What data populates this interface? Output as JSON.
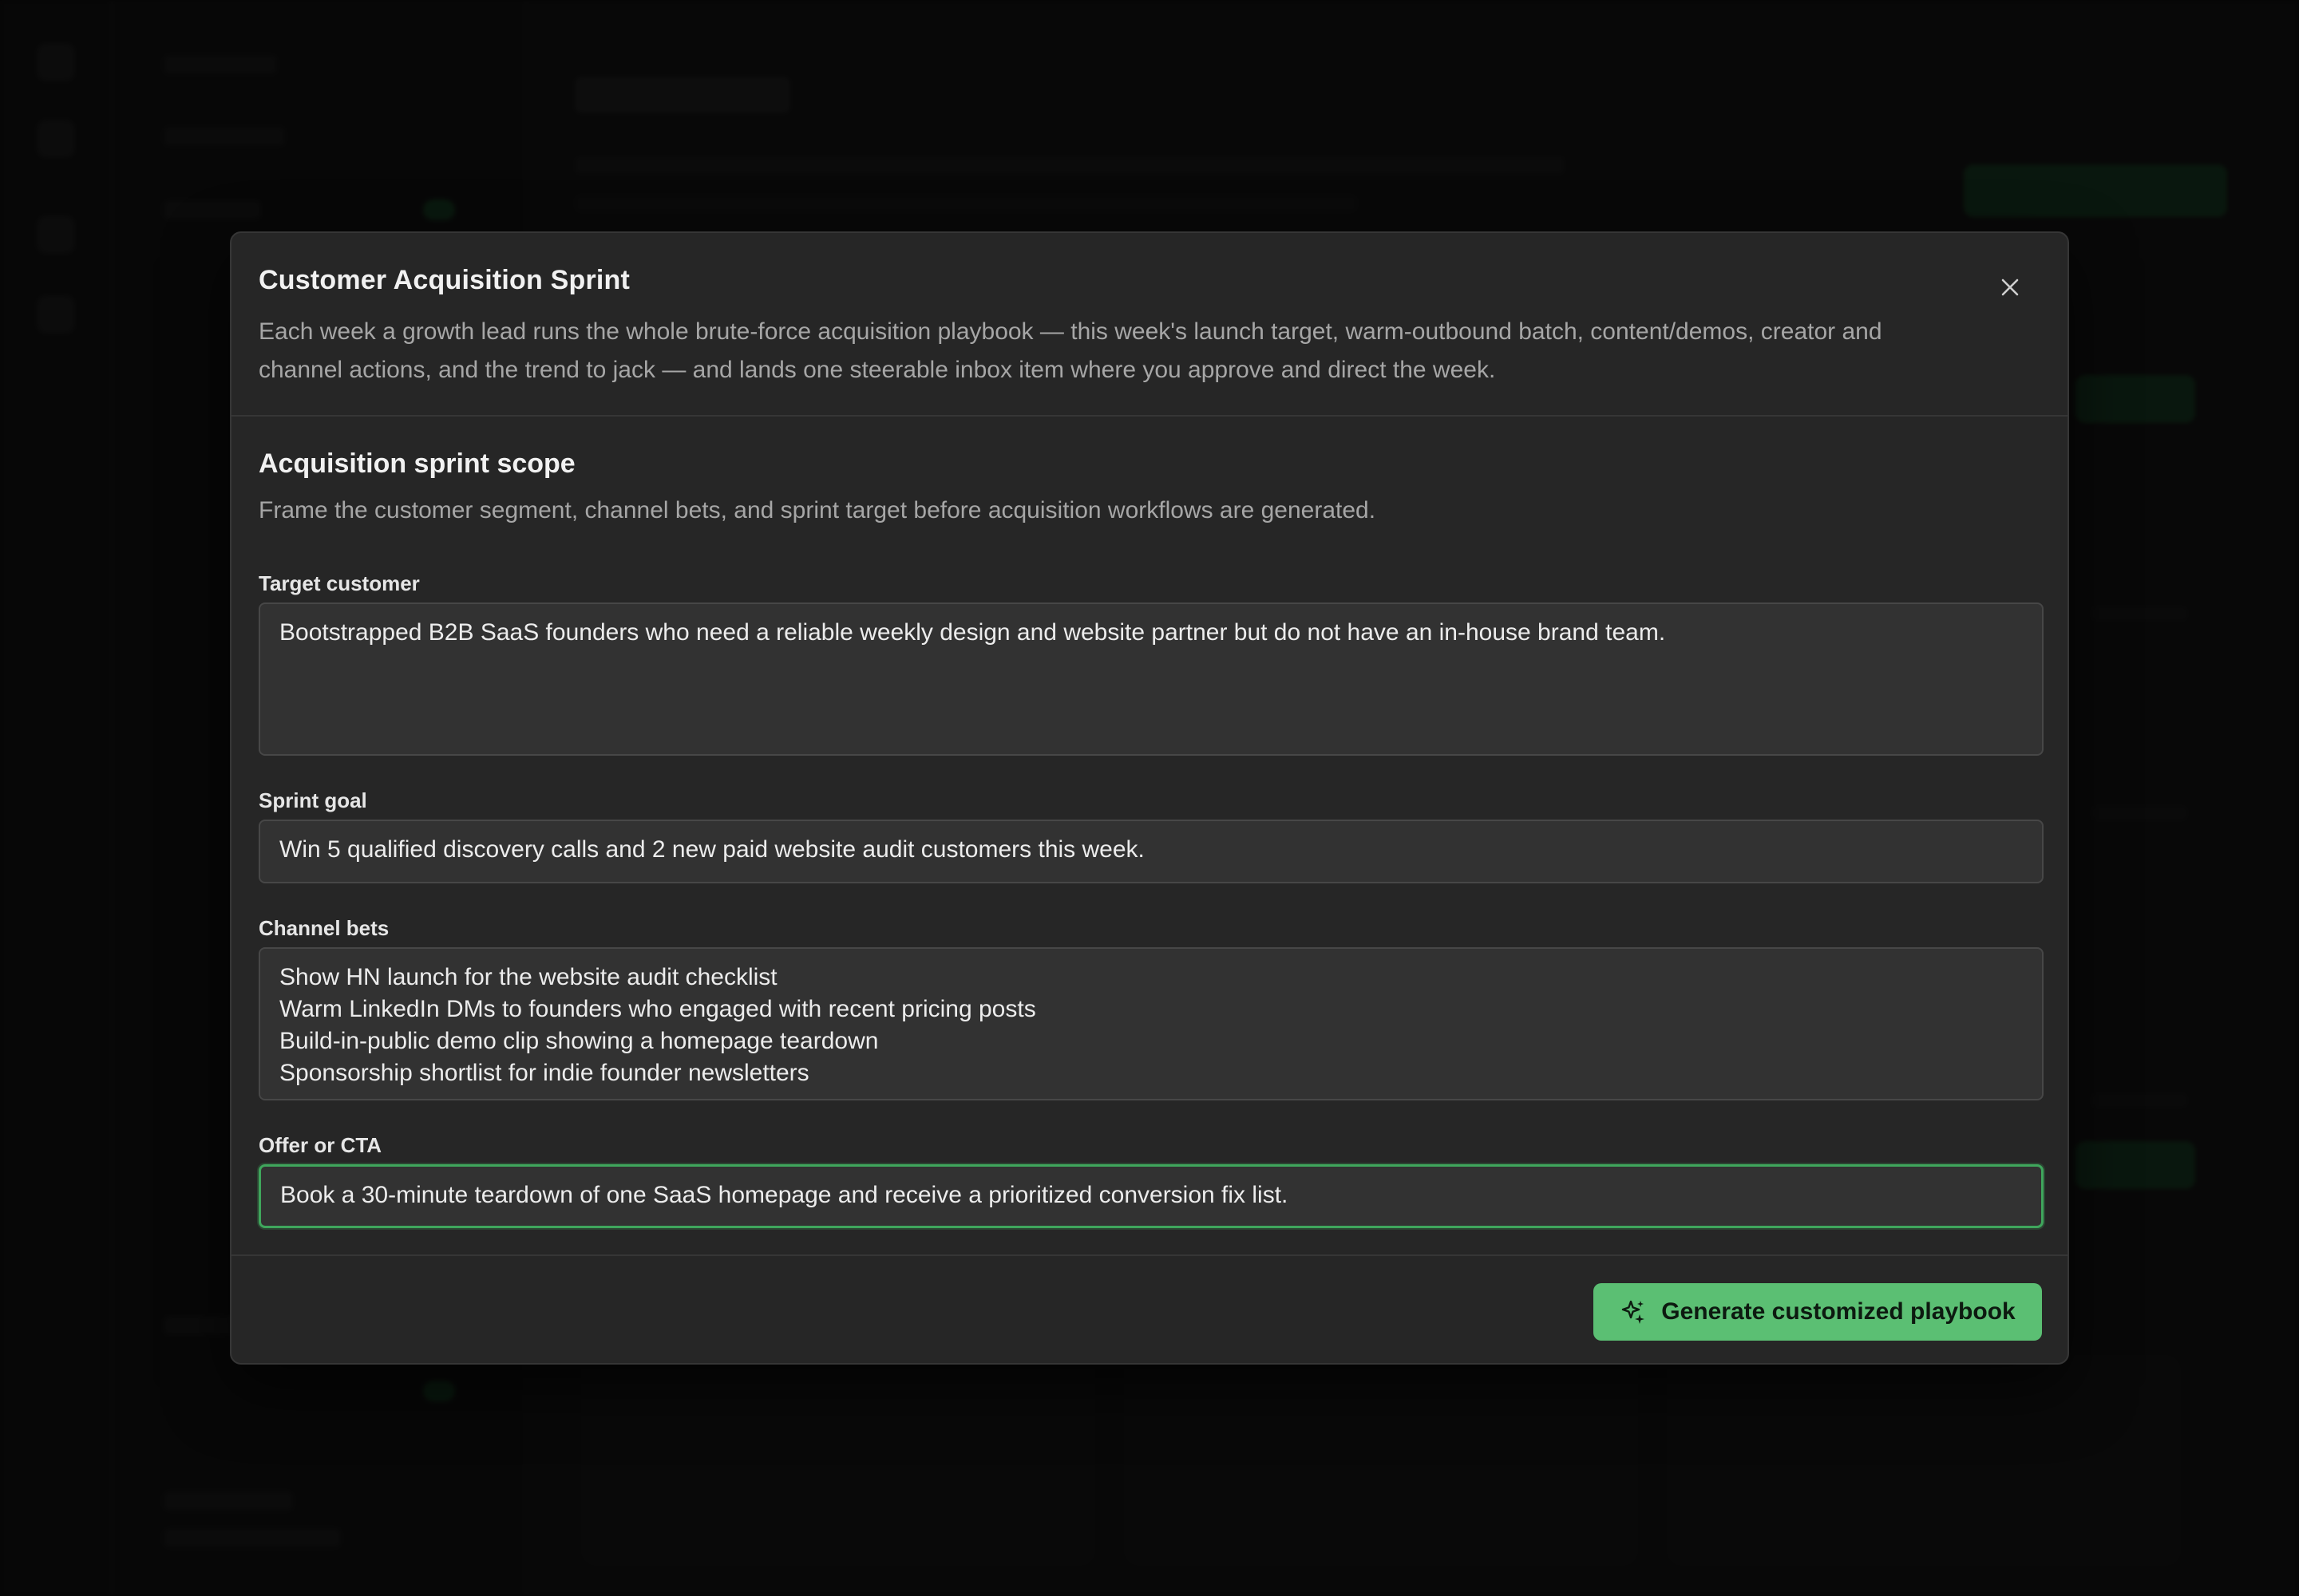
{
  "modal": {
    "title": "Customer Acquisition Sprint",
    "description": "Each week a growth lead runs the whole brute-force acquisition playbook — this week's launch target, warm-outbound batch, content/demos, creator and channel actions, and the trend to jack — and lands one steerable inbox item where you approve and direct the week.",
    "close_icon": "close-icon",
    "section": {
      "title": "Acquisition sprint scope",
      "description": "Frame the customer segment, channel bets, and sprint target before acquisition workflows are generated."
    },
    "fields": {
      "target_customer": {
        "label": "Target customer",
        "value": "Bootstrapped B2B SaaS founders who need a reliable weekly design and website partner but do not have an in-house brand team."
      },
      "sprint_goal": {
        "label": "Sprint goal",
        "value": "Win 5 qualified discovery calls and 2 new paid website audit customers this week."
      },
      "channel_bets": {
        "label": "Channel bets",
        "lines": [
          "Show HN launch for the website audit checklist",
          "Warm LinkedIn DMs to founders who engaged with recent pricing posts",
          "Build-in-public demo clip showing a homepage teardown",
          "Sponsorship shortlist for indie founder newsletters"
        ]
      },
      "offer_cta": {
        "label": "Offer or CTA",
        "value": "Book a 30-minute teardown of one SaaS homepage and receive a prioritized conversion fix list."
      }
    },
    "footer": {
      "generate_label": "Generate customized playbook",
      "generate_icon": "sparkles-icon"
    }
  },
  "colors": {
    "accent": "#5bbf73",
    "focus_border": "#3fa65c",
    "modal_bg": "#262626",
    "field_bg": "#323232"
  }
}
